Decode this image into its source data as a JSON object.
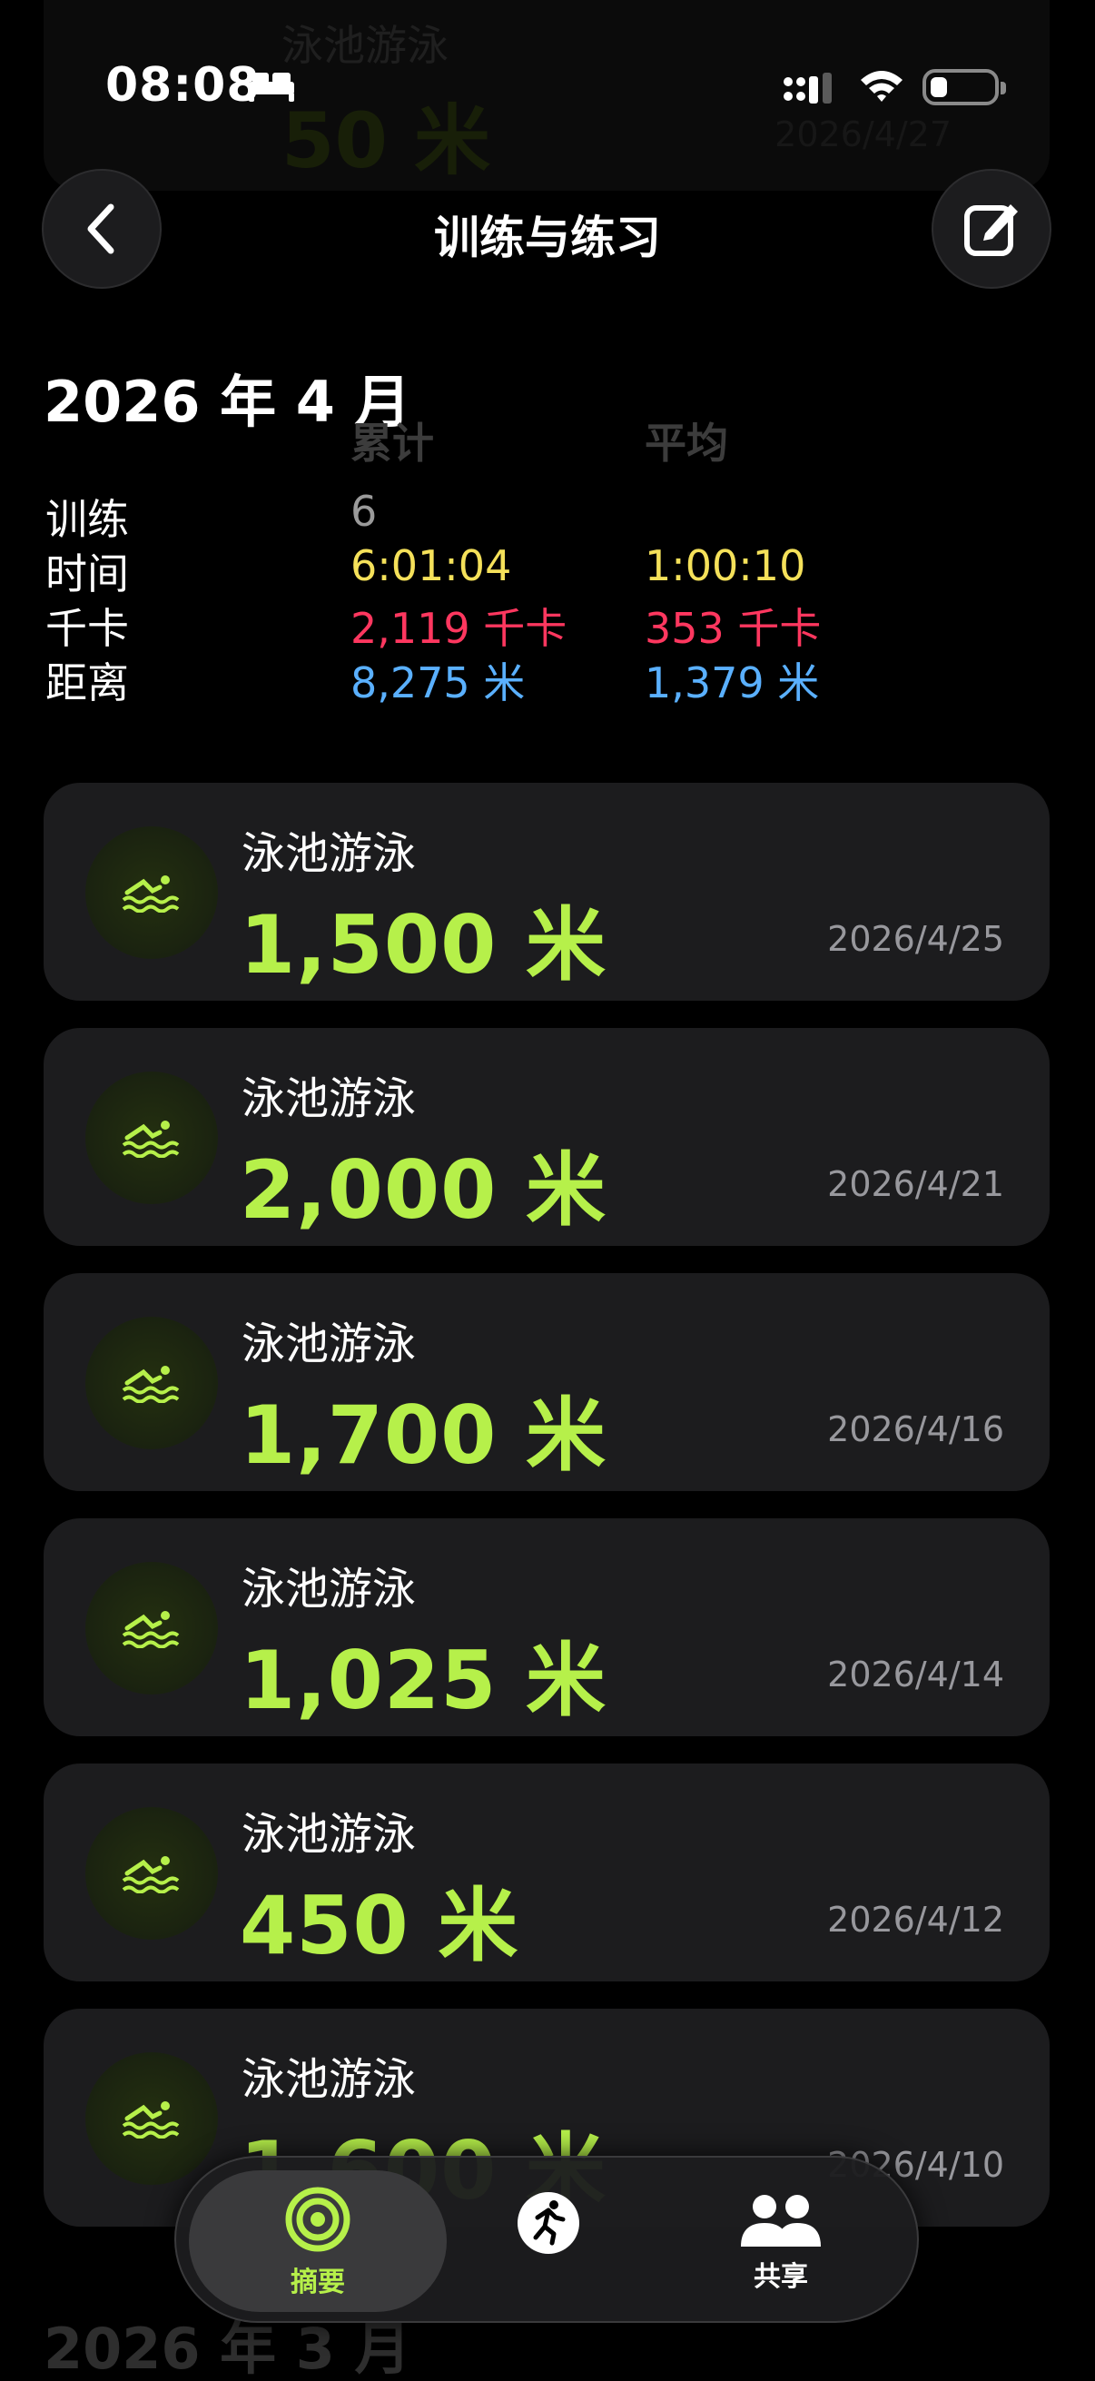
{
  "status_bar": {
    "time": "08:08"
  },
  "nav": {
    "title": "训练与练习"
  },
  "ghost_card": {
    "title": "泳池游泳",
    "distance": "50 米",
    "date": "2026/4/27"
  },
  "summary": {
    "month": "2026 年 4 月",
    "col_total": "累计",
    "col_avg": "平均",
    "rows": [
      {
        "label": "训练",
        "total": "6",
        "avg": ""
      },
      {
        "label": "时间",
        "total": "6:01:04",
        "avg": "1:00:10"
      },
      {
        "label": "千卡",
        "total": "2,119 千卡",
        "avg": "353 千卡"
      },
      {
        "label": "距离",
        "total": "8,275 米",
        "avg": "1,379 米"
      }
    ],
    "colors": {
      "workouts": "#9a9a9a",
      "time": "#f5e15a",
      "calories": "#ff375f",
      "distance": "#5ab0ff"
    }
  },
  "workouts": [
    {
      "title": "泳池游泳",
      "distance": "1,500 米",
      "date": "2026/4/25",
      "icon": "pool-swim-icon"
    },
    {
      "title": "泳池游泳",
      "distance": "2,000 米",
      "date": "2026/4/21",
      "icon": "pool-swim-icon"
    },
    {
      "title": "泳池游泳",
      "distance": "1,700 米",
      "date": "2026/4/16",
      "icon": "pool-swim-icon"
    },
    {
      "title": "泳池游泳",
      "distance": "1,025 米",
      "date": "2026/4/14",
      "icon": "pool-swim-icon"
    },
    {
      "title": "泳池游泳",
      "distance": "450 米",
      "date": "2026/4/12",
      "icon": "pool-swim-icon"
    },
    {
      "title": "泳池游泳",
      "distance": "1,600 米",
      "date": "2026/4/10",
      "icon": "pool-swim-icon"
    }
  ],
  "next_month": "2026 年 3 月",
  "tabbar": {
    "tabs": [
      {
        "label": "摘要",
        "icon": "activity-rings-icon",
        "active": true
      },
      {
        "label": "",
        "icon": "running-figure-icon",
        "active": false
      },
      {
        "label": "共享",
        "icon": "people-icon",
        "active": false
      }
    ],
    "accent": "#b6f04a"
  }
}
